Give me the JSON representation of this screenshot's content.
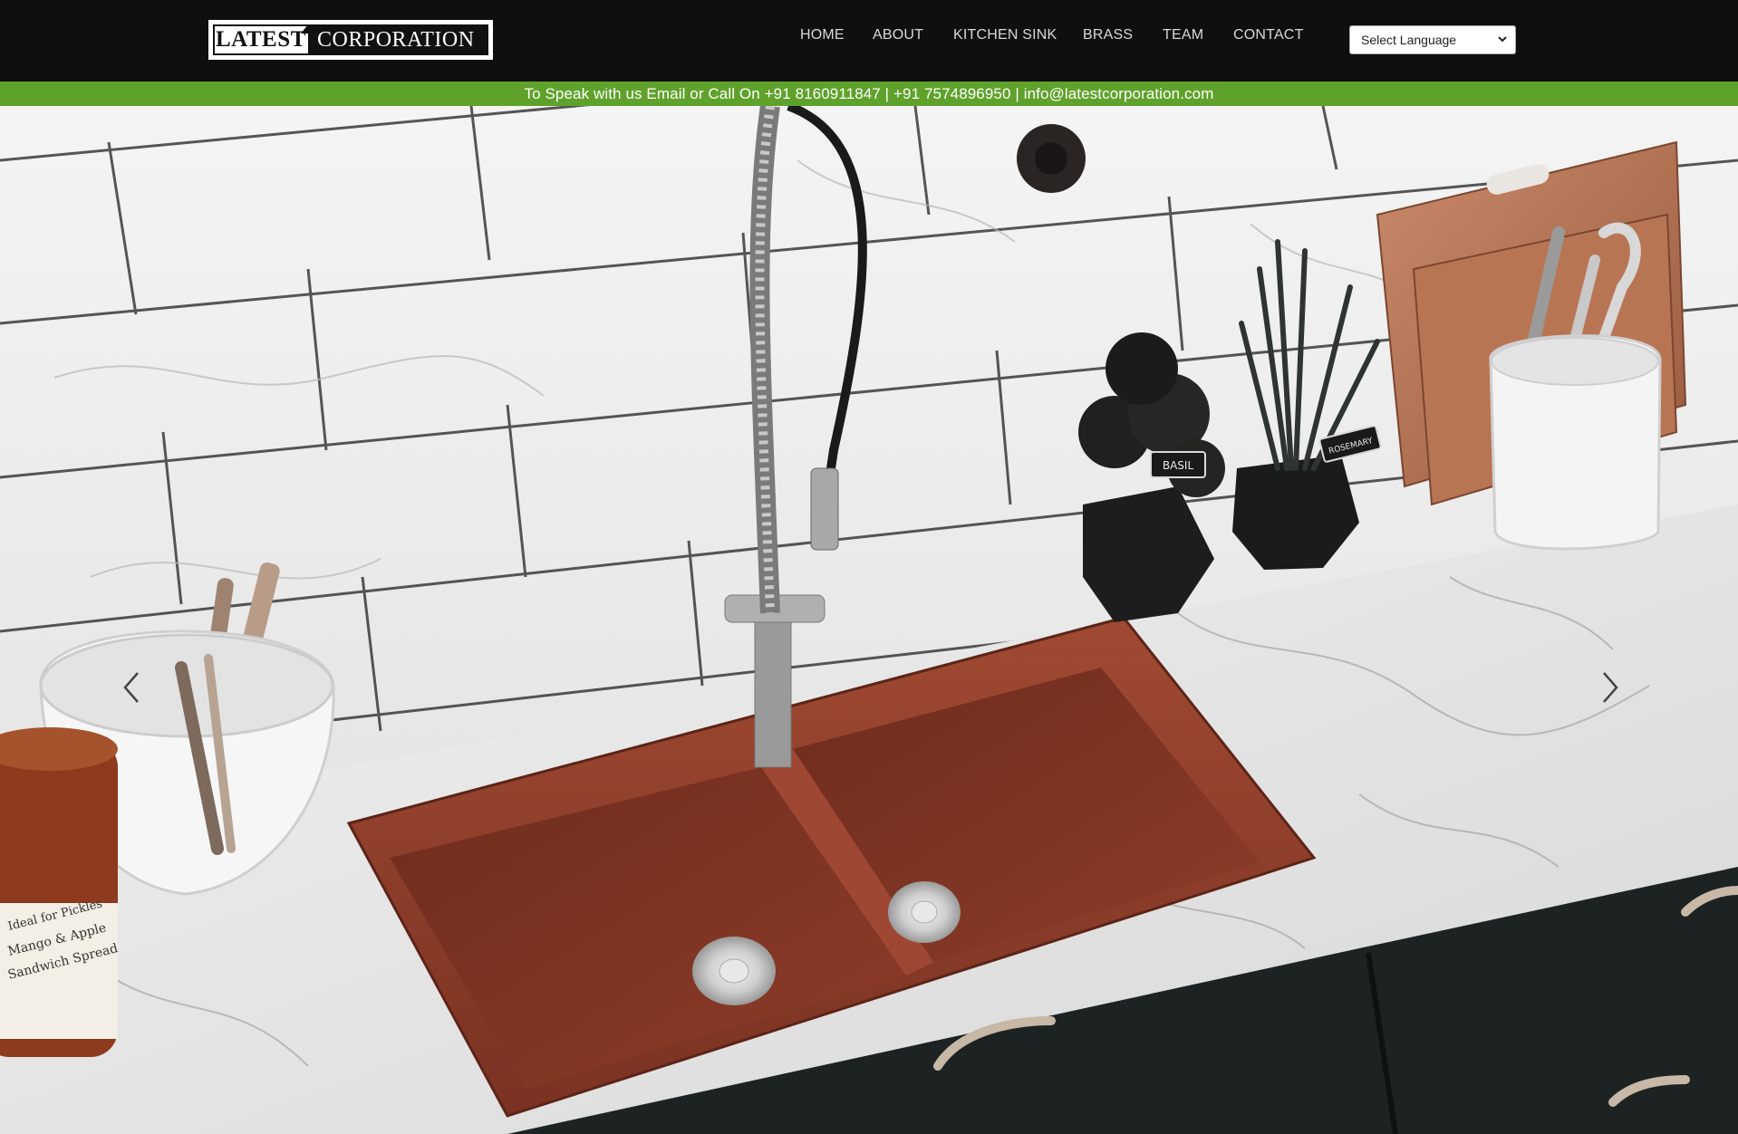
{
  "logo": {
    "left": "LATEST",
    "right": "CORPORATION"
  },
  "nav": {
    "items": [
      {
        "label": "HOME"
      },
      {
        "label": "ABOUT"
      },
      {
        "label": "KITCHEN SINK"
      },
      {
        "label": "BRASS"
      },
      {
        "label": "TEAM"
      },
      {
        "label": "CONTACT"
      }
    ]
  },
  "language": {
    "selected": "Select Language"
  },
  "contact_strip": {
    "text": "To Speak with us Email or Call On +91 8160911847 | +91 7574896950 | info@latestcorporation.com"
  },
  "hero": {
    "image": "kitchen-sink-product-photo",
    "prev_icon": "chevron-left-icon",
    "next_icon": "chevron-right-icon",
    "herb_labels": [
      "BASIL",
      "ROSEMARY"
    ],
    "jar_label": [
      "Ideal for Pickles",
      "Mango & Apple",
      "Sandwich Spread"
    ],
    "colors": {
      "sink": "#8a3b28",
      "cabinet": "#1c2322",
      "countertop": "#ececec"
    }
  }
}
